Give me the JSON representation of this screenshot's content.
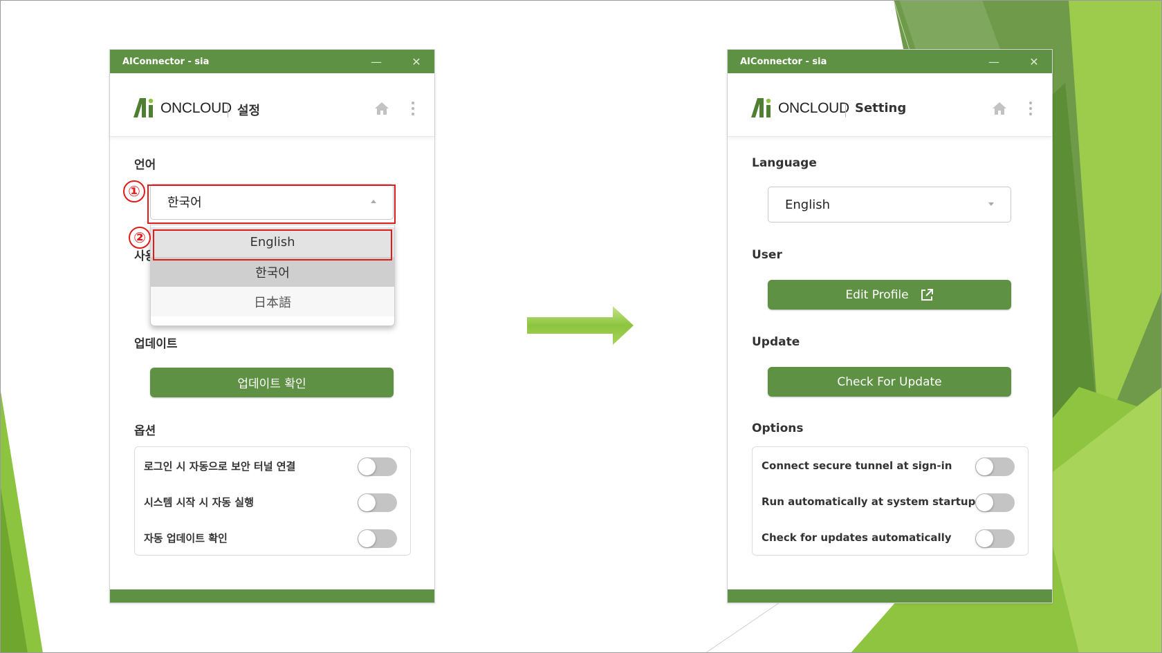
{
  "colors": {
    "brand_green": "#5e9143",
    "highlight_red": "#e01b1b",
    "toggle_off": "#c4c4c4",
    "arrow_green": "#8cc43f"
  },
  "left_window": {
    "title": "AIConnector - sia",
    "logo_text": "ONCLOUD",
    "header_title": "설정",
    "language": {
      "label": "언어",
      "selected": "한국어",
      "options": [
        "English",
        "한국어",
        "日本語"
      ],
      "hidden_user_label_fragment": "사용"
    },
    "update": {
      "label": "업데이트",
      "button": "업데이트 확인"
    },
    "options": {
      "label": "옵션",
      "items": [
        {
          "text": "로그인 시 자동으로 보안 터널 연결",
          "enabled": false
        },
        {
          "text": "시스템 시작 시 자동 실행",
          "enabled": false
        },
        {
          "text": "자동 업데이트 확인",
          "enabled": false
        }
      ]
    },
    "annotations": {
      "step1": "①",
      "step2": "②"
    }
  },
  "right_window": {
    "title": "AIConnector - sia",
    "logo_text": "ONCLOUD",
    "header_title": "Setting",
    "language": {
      "label": "Language",
      "selected": "English"
    },
    "user": {
      "label": "User",
      "button": "Edit Profile"
    },
    "update": {
      "label": "Update",
      "button": "Check For Update"
    },
    "options": {
      "label": "Options",
      "items": [
        {
          "text": "Connect secure tunnel at sign-in",
          "enabled": false
        },
        {
          "text": "Run automatically at system startup",
          "enabled": false
        },
        {
          "text": "Check for updates automatically",
          "enabled": false
        }
      ]
    }
  }
}
